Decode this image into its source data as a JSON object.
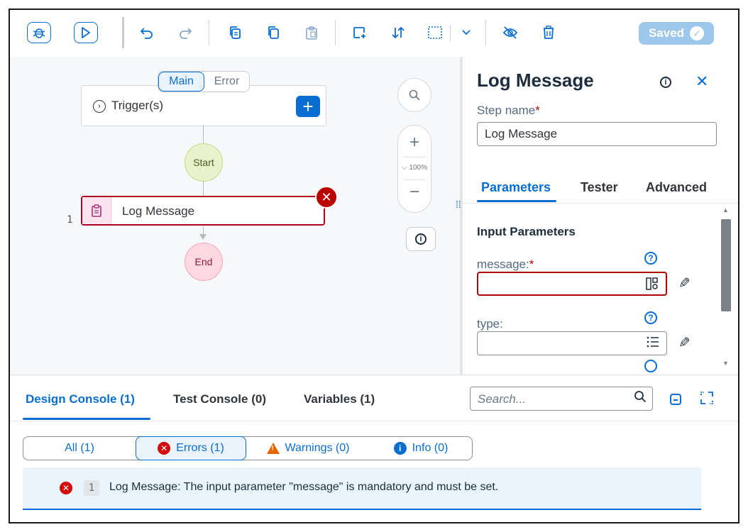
{
  "toolbar": {
    "saved_label": "Saved",
    "icons": [
      "debug-icon",
      "run-icon",
      "undo-icon",
      "redo-icon",
      "copy-step-icon",
      "duplicate-icon",
      "paste-icon",
      "add-group-icon",
      "sort-icon",
      "select-area-icon",
      "chevron-down-icon",
      "hide-icon",
      "delete-icon",
      "check-icon"
    ]
  },
  "canvas": {
    "tabs": [
      {
        "label": "Main"
      },
      {
        "label": "Error"
      }
    ],
    "trigger_label": "Trigger(s)",
    "add_symbol": "+",
    "start_label": "Start",
    "end_label": "End",
    "step_number": "1",
    "step_label": "Log Message",
    "zoom_level": "100%"
  },
  "panel": {
    "title": "Log Message",
    "step_name_label": "Step name",
    "required_mark": "*",
    "step_name_value": "Log Message",
    "tabs": [
      {
        "label": "Parameters"
      },
      {
        "label": "Tester"
      },
      {
        "label": "Advanced"
      }
    ],
    "section_title": "Input Parameters",
    "fields": [
      {
        "label": "message:",
        "required": true,
        "value": ""
      },
      {
        "label": "type:",
        "required": false,
        "value": ""
      }
    ]
  },
  "console": {
    "tabs": [
      {
        "label": "Design Console (1)"
      },
      {
        "label": "Test Console (0)"
      },
      {
        "label": "Variables (1)"
      }
    ],
    "search_placeholder": "Search...",
    "filters": [
      {
        "label": "All (1)"
      },
      {
        "label": "Errors (1)"
      },
      {
        "label": "Warnings (0)"
      },
      {
        "label": "Info (0)"
      }
    ],
    "messages": [
      {
        "num": "1",
        "text": "Log Message: The input parameter \"message\" is mandatory and must be set."
      }
    ]
  },
  "colors": {
    "accent": "#0a6ed1",
    "error": "#bb0000",
    "warning": "#e76500",
    "saved": "#9ec7ec"
  }
}
